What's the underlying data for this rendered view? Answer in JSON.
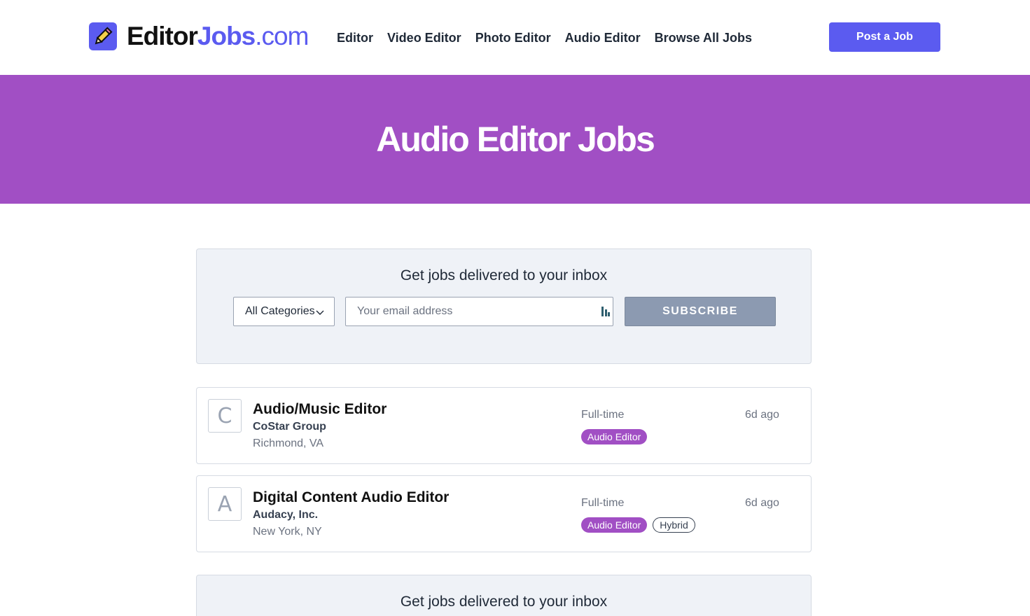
{
  "header": {
    "logo": {
      "part1": "Editor",
      "part2": "Jobs",
      "part3": ".com",
      "icon": "pencil-icon"
    },
    "nav": [
      "Editor",
      "Video Editor",
      "Photo Editor",
      "Audio Editor",
      "Browse All Jobs"
    ],
    "post_button": "Post a Job"
  },
  "hero": {
    "title": "Audio Editor Jobs"
  },
  "subscribe": {
    "title": "Get jobs delivered to your inbox",
    "category": "All Categories",
    "email_placeholder": "Your email address",
    "button": "SUBSCRIBE"
  },
  "jobs": [
    {
      "logo_letter": "C",
      "title": "Audio/Music Editor",
      "company": "CoStar Group",
      "location": "Richmond, VA",
      "type": "Full-time",
      "age": "6d ago",
      "tags": [
        "Audio Editor"
      ]
    },
    {
      "logo_letter": "A",
      "title": "Digital Content Audio Editor",
      "company": "Audacy, Inc.",
      "location": "New York, NY",
      "type": "Full-time",
      "age": "6d ago",
      "tags": [
        "Audio Editor",
        "Hybrid"
      ]
    }
  ],
  "subscribe_bottom": {
    "title": "Get jobs delivered to your inbox"
  },
  "colors": {
    "brand": "#5b5bf0",
    "hero": "#a14fc4",
    "tag": "#a14fc4",
    "subscribe_button": "#8c9ab1"
  }
}
